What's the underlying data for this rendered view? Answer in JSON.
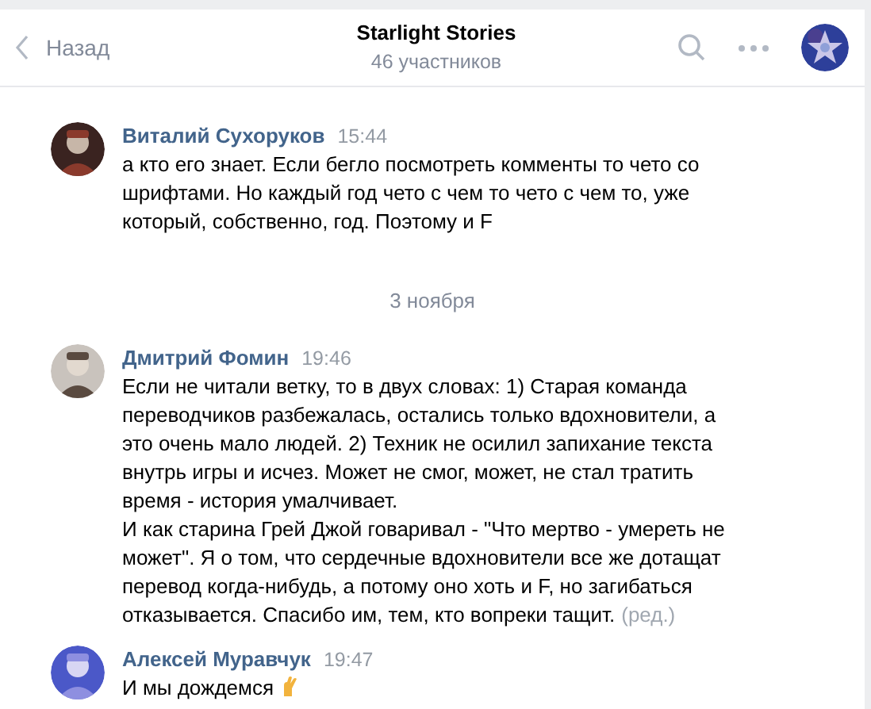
{
  "header": {
    "back_label": "Назад",
    "title": "Starlight Stories",
    "subtitle": "46 участников"
  },
  "feed": [
    {
      "kind": "message",
      "author": "Виталий Сухоруков",
      "time": "15:44",
      "text": "а кто его знает. Если бегло посмотреть комменты то чето со шрифтами. Но каждый год чето с чем то чето с чем то, уже который, собственно, год. Поэтому и F"
    },
    {
      "kind": "date",
      "text": "3 ноября"
    },
    {
      "kind": "message",
      "author": "Дмитрий Фомин",
      "time": "19:46",
      "text": "Если не читали ветку, то в двух словах: 1) Старая команда переводчиков разбежалась, остались только вдохновители, а это очень мало людей. 2) Техник не осилил запихание текста внутрь игры и исчез. Может не смог, может, не стал тратить время - история умалчивает.\nИ как старина Грей Джой говаривал - \"Что мертво - умереть не может\". Я о том, что сердечные вдохновители все же дотащат перевод когда-нибудь, а потому оно хоть и F, но загибаться отказывается. Спасибо им, тем, кто вопреки тащит.",
      "edited_mark": "(ред.)"
    },
    {
      "kind": "message",
      "author": "Алексей Муравчук",
      "time": "19:47",
      "text": "И мы дождемся",
      "emoji": true
    }
  ]
}
